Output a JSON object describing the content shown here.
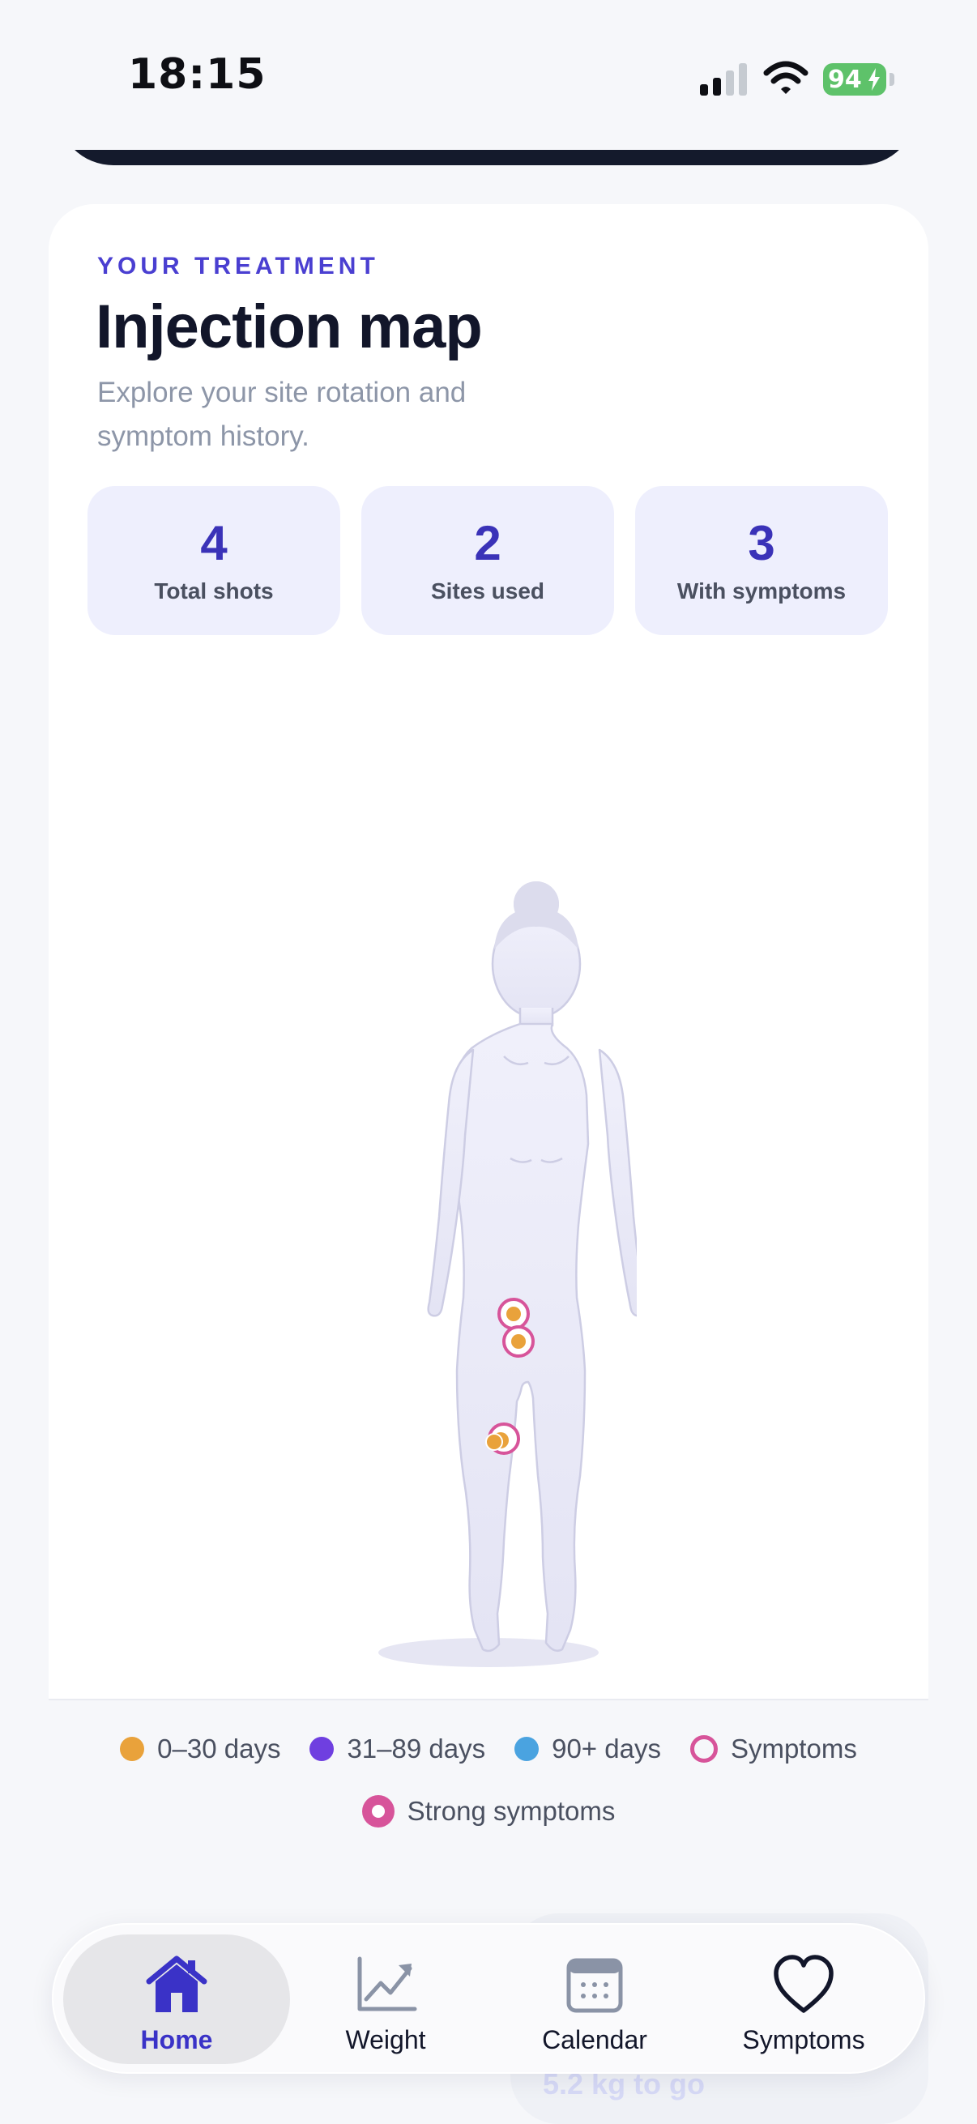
{
  "status_bar": {
    "time": "18:15",
    "battery": "94"
  },
  "treatment": {
    "eyebrow": "YOUR TREATMENT",
    "title": "Injection map",
    "subtitle": "Explore your site rotation and symptom history."
  },
  "stats": [
    {
      "value": "4",
      "label": "Total shots"
    },
    {
      "value": "2",
      "label": "Sites used"
    },
    {
      "value": "3",
      "label": "With symptoms"
    }
  ],
  "legend": {
    "items": [
      {
        "label": "0–30 days",
        "color": "#e9a23b"
      },
      {
        "label": "31–89 days",
        "color": "#6f3fe0"
      },
      {
        "label": "90+ days",
        "color": "#4aa3e0"
      },
      {
        "label": "Symptoms",
        "color": "#d7549a"
      },
      {
        "label": "Strong symptoms",
        "color": "#d7549a"
      }
    ]
  },
  "background_card": {
    "text": "5.2 kg to go"
  },
  "tabs": [
    {
      "label": "Home",
      "icon": "house-icon",
      "active": true
    },
    {
      "label": "Weight",
      "icon": "trend-chart-icon",
      "active": false
    },
    {
      "label": "Calendar",
      "icon": "calendar-icon",
      "active": false
    },
    {
      "label": "Symptoms",
      "icon": "heart-icon",
      "active": false
    }
  ],
  "colors": {
    "accent": "#4a3fd1",
    "recent_site": "#e9a23b",
    "symptom_ring": "#d7549a",
    "figure_fill": "#ebebf8"
  }
}
